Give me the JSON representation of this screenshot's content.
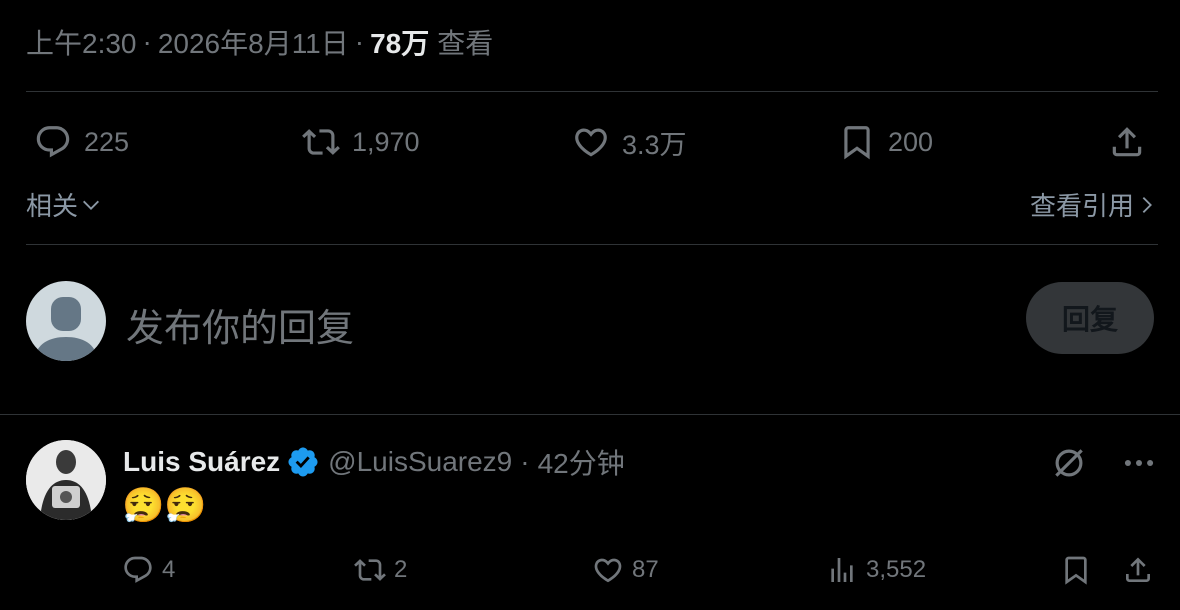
{
  "post_meta": {
    "time": "上午2:30",
    "sep1": "·",
    "date": "2026年8月11日",
    "sep2": "·",
    "views": "78万",
    "views_label": "查看"
  },
  "post_actions": {
    "replies": "225",
    "reposts": "1,970",
    "likes": "3.3万",
    "bookmarks": "200"
  },
  "related": {
    "label": "相关",
    "quotes_link": "查看引用"
  },
  "compose": {
    "placeholder": "发布你的回复",
    "reply_button": "回复"
  },
  "reply_tweet": {
    "name": "Luis Suárez",
    "handle": "@LuisSuarez9",
    "sep": "·",
    "time": "42分钟",
    "text": "😮‍💨😮‍💨",
    "actions": {
      "replies": "4",
      "reposts": "2",
      "likes": "87",
      "views": "3,552"
    }
  },
  "colors": {
    "background": "#000000",
    "text_primary": "#e7e9ea",
    "text_muted": "#71767b",
    "divider": "#2f3336",
    "verified_blue": "#1d9bf0",
    "reply_button_bg": "#333639"
  },
  "icons": [
    "reply-icon",
    "repost-icon",
    "like-icon",
    "bookmark-icon",
    "share-icon",
    "chevron-down-icon",
    "chevron-right-icon",
    "verified-badge-icon",
    "grok-icon",
    "more-icon",
    "views-icon"
  ]
}
